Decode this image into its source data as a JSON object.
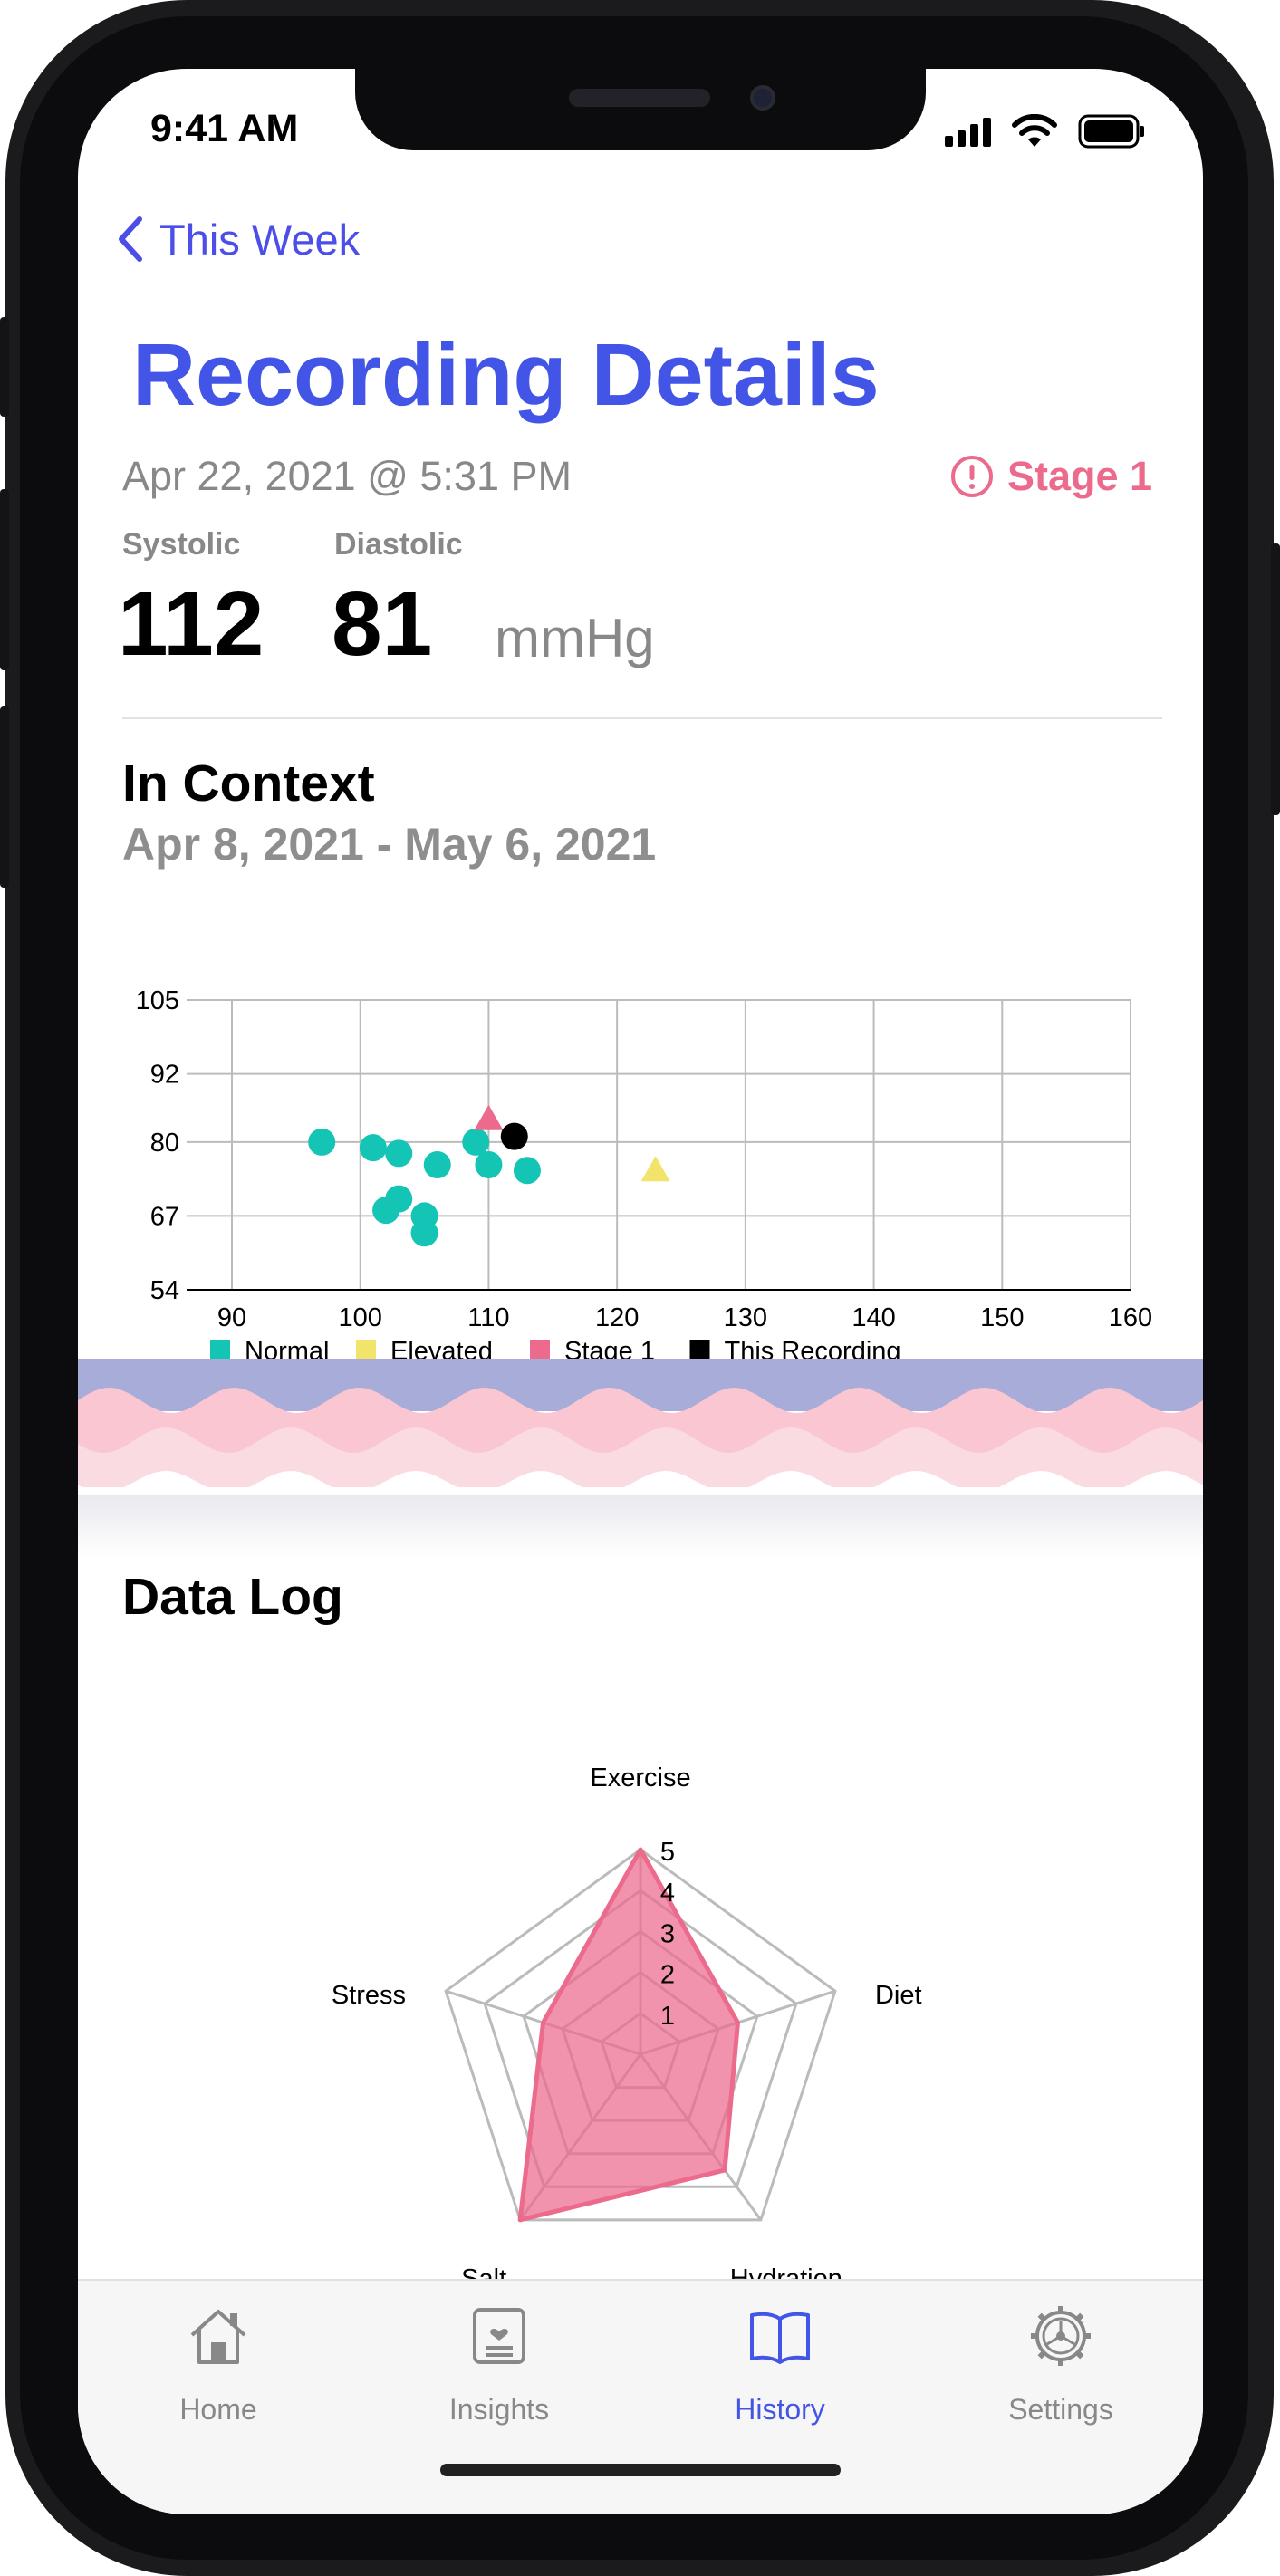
{
  "status_bar": {
    "time": "9:41 AM"
  },
  "nav": {
    "back_label": "This Week"
  },
  "header": {
    "title": "Recording Details",
    "date": "Apr 22, 2021 @ 5:31 PM",
    "stage_label": "Stage 1"
  },
  "reading": {
    "systolic_label": "Systolic",
    "systolic_value": "112",
    "diastolic_label": "Diastolic",
    "diastolic_value": "81",
    "unit": "mmHg"
  },
  "context": {
    "title": "In Context",
    "range": "Apr 8, 2021 - May 6, 2021"
  },
  "data_log": {
    "title": "Data Log"
  },
  "colors": {
    "accent": "#4255e6",
    "normal": "#14c4b4",
    "elevated": "#f2e46a",
    "stage1": "#ec6a8c",
    "this_recording": "#000000"
  },
  "chart_data": [
    {
      "type": "scatter",
      "title": "",
      "xlabel": "",
      "ylabel": "",
      "xlim": [
        90,
        160
      ],
      "ylim": [
        54,
        105
      ],
      "x_ticks": [
        "90",
        "100",
        "110",
        "120",
        "130",
        "140",
        "150",
        "160"
      ],
      "y_ticks": [
        "105",
        "92",
        "80",
        "67",
        "54"
      ],
      "grid": true,
      "legend_position": "bottom",
      "series": [
        {
          "name": "Normal",
          "color": "#14c4b4",
          "marker": "circle",
          "points": [
            [
              97,
              80
            ],
            [
              101,
              79
            ],
            [
              103,
              78
            ],
            [
              106,
              76
            ],
            [
              109,
              80
            ],
            [
              110,
              76
            ],
            [
              113,
              75
            ],
            [
              103,
              70
            ],
            [
              102,
              68
            ],
            [
              105,
              67
            ],
            [
              105,
              64
            ]
          ]
        },
        {
          "name": "Elevated",
          "color": "#f2e46a",
          "marker": "triangle",
          "points": [
            [
              123,
              75
            ]
          ]
        },
        {
          "name": "Stage 1",
          "color": "#ec6a8c",
          "marker": "triangle",
          "points": [
            [
              110,
              84
            ]
          ]
        },
        {
          "name": "This Recording",
          "color": "#000000",
          "marker": "circle",
          "points": [
            [
              112,
              81
            ]
          ]
        }
      ]
    },
    {
      "type": "radar",
      "axes": [
        "Exercise",
        "Diet",
        "Hydration",
        "Salt",
        "Stress"
      ],
      "scale_ticks": [
        "1",
        "2",
        "3",
        "4",
        "5"
      ],
      "max": 5,
      "values": [
        5,
        2.5,
        3.5,
        5,
        2.5
      ],
      "color": "#ec6a8c"
    }
  ],
  "tab_bar": {
    "items": [
      {
        "label": "Home",
        "icon": "house-icon",
        "active": false
      },
      {
        "label": "Insights",
        "icon": "insights-card-icon",
        "active": false
      },
      {
        "label": "History",
        "icon": "book-icon",
        "active": true
      },
      {
        "label": "Settings",
        "icon": "gear-icon",
        "active": false
      }
    ]
  }
}
